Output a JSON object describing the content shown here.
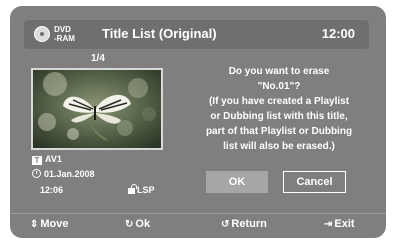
{
  "header": {
    "disc_line1": "DVD",
    "disc_line2": "-RAM",
    "title": "Title List (Original)",
    "clock": "12:00"
  },
  "title_info": {
    "counter": "1/4",
    "channel": "AV1",
    "date": "01.Jan.2008",
    "time": "12:06",
    "mode": "LSP"
  },
  "dialog": {
    "message": "Do you want to erase\n\"No.01\"?\n(If you have created a Playlist\nor Dubbing list with this title,\npart of that Playlist or Dubbing\nlist will also be erased.)",
    "ok_label": "OK",
    "cancel_label": "Cancel"
  },
  "footer": {
    "move_label": "Move",
    "ok_label": "Ok",
    "return_label": "Return",
    "exit_label": "Exit"
  },
  "colors": {
    "background": "#7f7f7f",
    "titlebar": "#6f6f6f",
    "ok_button": "#a6a6a6",
    "text": "#ffffff"
  }
}
